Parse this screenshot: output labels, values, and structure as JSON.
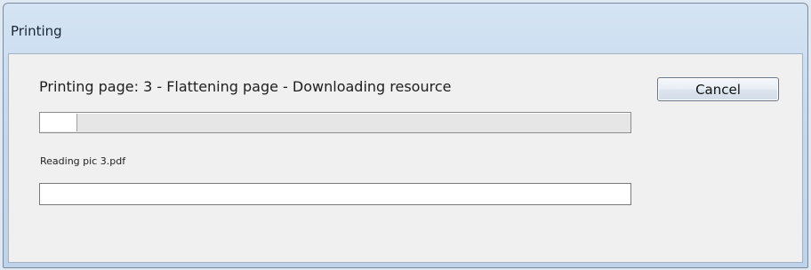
{
  "window": {
    "title": "Printing"
  },
  "status": {
    "main_text": "Printing page: 3 - Flattening page - Downloading resource",
    "sub_text": "Reading pic 3.pdf"
  },
  "progress": {
    "page_progress": 0.06,
    "file_progress": 0
  },
  "buttons": {
    "cancel_label": "Cancel"
  },
  "colors": {
    "title_bar": "#c6d9ee",
    "client_bg": "#f0f0f0"
  }
}
